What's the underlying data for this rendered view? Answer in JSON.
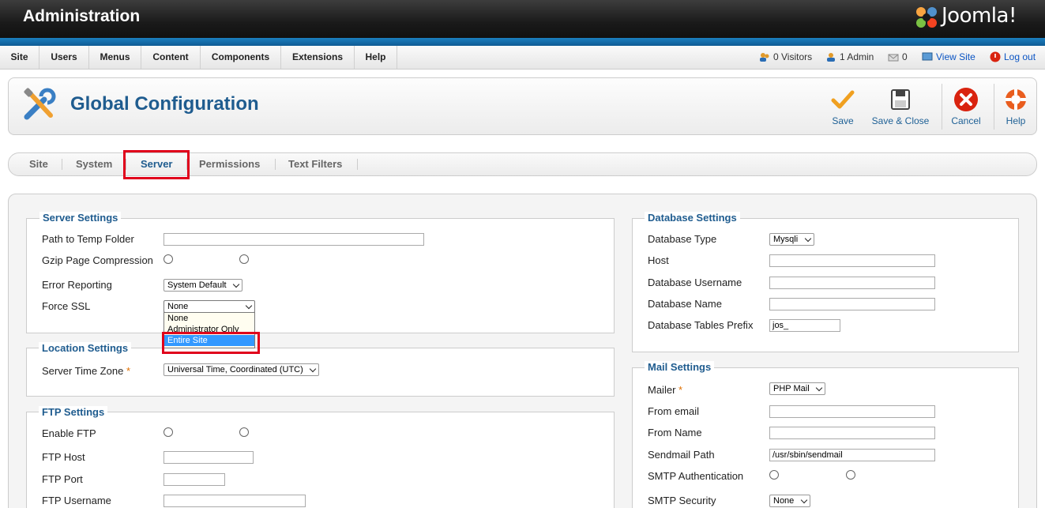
{
  "header": {
    "title": "Administration",
    "logo_text": "Joomla!"
  },
  "menu": {
    "items": [
      {
        "label": "Site"
      },
      {
        "label": "Users"
      },
      {
        "label": "Menus"
      },
      {
        "label": "Content"
      },
      {
        "label": "Components"
      },
      {
        "label": "Extensions"
      },
      {
        "label": "Help"
      }
    ]
  },
  "status": {
    "visitors": "0 Visitors",
    "admins": "1 Admin",
    "messages": "0",
    "view_site": "View Site",
    "logout": "Log out"
  },
  "page": {
    "title": "Global Configuration"
  },
  "toolbar": {
    "save": "Save",
    "save_close": "Save & Close",
    "cancel": "Cancel",
    "help": "Help"
  },
  "tabs": [
    {
      "label": "Site"
    },
    {
      "label": "System"
    },
    {
      "label": "Server",
      "active": true
    },
    {
      "label": "Permissions"
    },
    {
      "label": "Text Filters"
    }
  ],
  "server_settings": {
    "legend": "Server Settings",
    "temp_path_label": "Path to Temp Folder",
    "temp_path_value": "",
    "gzip_label": "Gzip Page Compression",
    "error_label": "Error Reporting",
    "error_value": "System Default",
    "ssl_label": "Force SSL",
    "ssl_value": "None",
    "ssl_options": [
      "None",
      "Administrator Only",
      "Entire Site"
    ],
    "ssl_highlighted_option": "Entire Site"
  },
  "location_settings": {
    "legend": "Location Settings",
    "timezone_label": "Server Time Zone",
    "timezone_value": "Universal Time, Coordinated (UTC)",
    "required_mark": "*"
  },
  "ftp_settings": {
    "legend": "FTP Settings",
    "enable_label": "Enable FTP",
    "host_label": "FTP Host",
    "port_label": "FTP Port",
    "username_label": "FTP Username"
  },
  "database_settings": {
    "legend": "Database Settings",
    "type_label": "Database Type",
    "type_value": "Mysqli",
    "host_label": "Host",
    "username_label": "Database Username",
    "name_label": "Database Name",
    "prefix_label": "Database Tables Prefix",
    "prefix_value": "jos_"
  },
  "mail_settings": {
    "legend": "Mail Settings",
    "mailer_label": "Mailer",
    "mailer_value": "PHP Mail",
    "required_mark": "*",
    "from_email_label": "From email",
    "from_name_label": "From Name",
    "sendmail_label": "Sendmail Path",
    "sendmail_value": "/usr/sbin/sendmail",
    "smtp_auth_label": "SMTP Authentication",
    "smtp_security_label": "SMTP Security",
    "smtp_security_value": "None"
  },
  "colors": {
    "accent": "#1f5c8f",
    "highlight": "#e0001b",
    "header_stripe": "#1b7fbf"
  }
}
